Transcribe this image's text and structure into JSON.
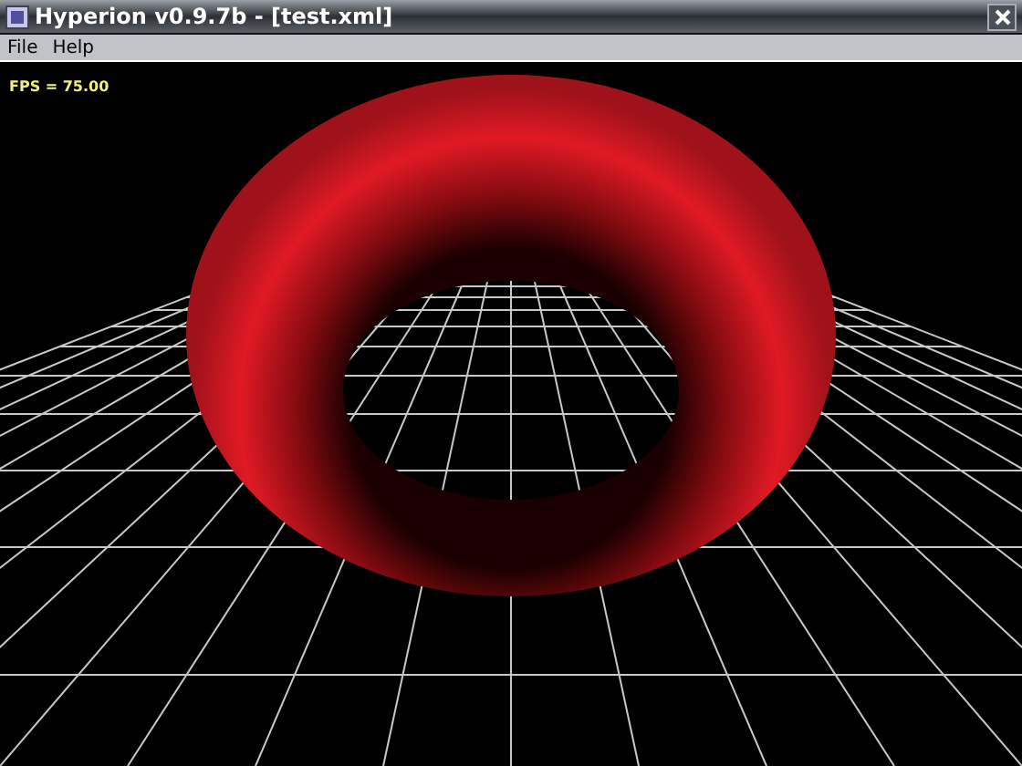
{
  "window": {
    "title": "Hyperion v0.9.7b - [test.xml]"
  },
  "menu": [
    "File",
    "Help"
  ],
  "viewport": {
    "fps": "FPS = 75.00"
  }
}
